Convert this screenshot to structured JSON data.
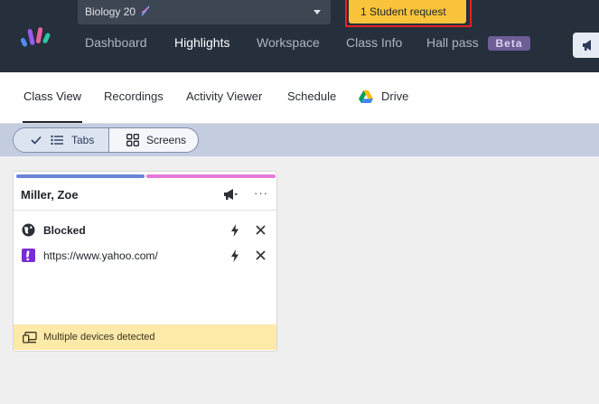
{
  "header": {
    "class_select": {
      "value": "Biology 20"
    },
    "student_request": "1 Student request",
    "nav": [
      {
        "label": "Dashboard",
        "active": false
      },
      {
        "label": "Highlights",
        "active": true
      },
      {
        "label": "Workspace",
        "active": false
      },
      {
        "label": "Class Info",
        "active": false
      },
      {
        "label": "Hall pass",
        "active": false
      }
    ],
    "beta_badge": "Beta"
  },
  "subnav": {
    "tabs": [
      {
        "label": "Class View",
        "active": true
      },
      {
        "label": "Recordings",
        "active": false
      },
      {
        "label": "Activity Viewer",
        "active": false
      },
      {
        "label": "Schedule",
        "active": false
      },
      {
        "label": "Drive",
        "active": false
      }
    ]
  },
  "view_toggle": {
    "tabs_label": "Tabs",
    "screens_label": "Screens",
    "selected": "Tabs"
  },
  "student_card": {
    "name": "Miller, Zoe",
    "more_label": "···",
    "rows": [
      {
        "title": "Blocked",
        "icon": "globe-icon"
      },
      {
        "title": "https://www.yahoo.com/",
        "icon": "yahoo-icon"
      }
    ],
    "warning": "Multiple devices detected"
  },
  "colors": {
    "topbar": "#262f3c",
    "request_button": "#f9c33c",
    "request_outline": "#e52222",
    "strip": "#c4cde0",
    "warning_bg": "#fde9a8",
    "bar_blue": "#6b83d6",
    "bar_pink": "#e877d7",
    "yahoo_purple": "#7b2bd6"
  }
}
